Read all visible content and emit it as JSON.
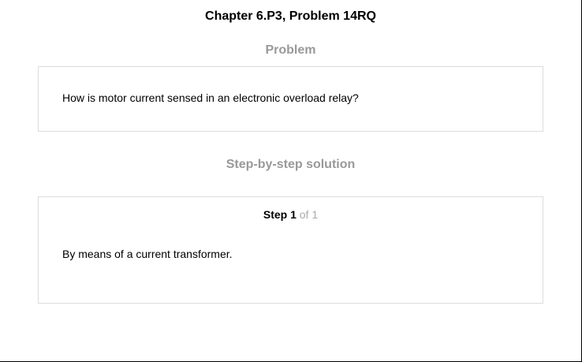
{
  "header": {
    "title": "Chapter 6.P3, Problem 14RQ"
  },
  "problem": {
    "heading": "Problem",
    "text": "How is motor current sensed in an electronic overload relay?"
  },
  "solution": {
    "heading": "Step-by-step solution",
    "steps": [
      {
        "label": "Step 1",
        "of_text": "of 1",
        "text": "By means of a current transformer."
      }
    ]
  },
  "colors": {
    "heading_gray": "#999999",
    "step_of_gray": "#aaaaaa",
    "card_border": "#dcdcdc"
  }
}
